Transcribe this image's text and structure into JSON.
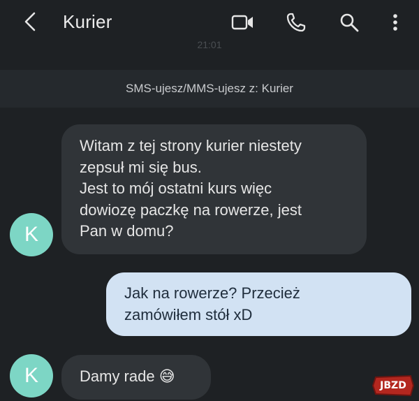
{
  "header": {
    "contact_name": "Kurier",
    "back_icon": "chevron-left-icon",
    "video_icon": "video-camera-icon",
    "phone_icon": "phone-icon",
    "search_icon": "search-icon",
    "menu_icon": "more-vertical-icon"
  },
  "conversation": {
    "date_label": "21:01",
    "banner": "SMS-ujesz/MMS-ujesz z: Kurier",
    "messages": [
      {
        "direction": "incoming",
        "avatar_letter": "K",
        "lines": [
          "Witam z tej strony kurier niestety",
          "zepsuł mi się bus.",
          "Jest to mój ostatni kurs więc",
          "dowiozę paczkę na rowerze, jest",
          "Pan w domu?"
        ]
      },
      {
        "direction": "outgoing",
        "lines": [
          "Jak na rowerze? Przecież",
          "zamówiłem stół xD"
        ]
      },
      {
        "direction": "incoming",
        "avatar_letter": "K",
        "text": "Damy rade",
        "emoji": "😅"
      }
    ]
  },
  "colors": {
    "background": "#1e2124",
    "incoming_bubble": "#303438",
    "outgoing_bubble": "#d2e2f3",
    "avatar": "#7dd6c5",
    "watermark": "#e53935"
  },
  "watermark": {
    "text": "JBZD"
  }
}
